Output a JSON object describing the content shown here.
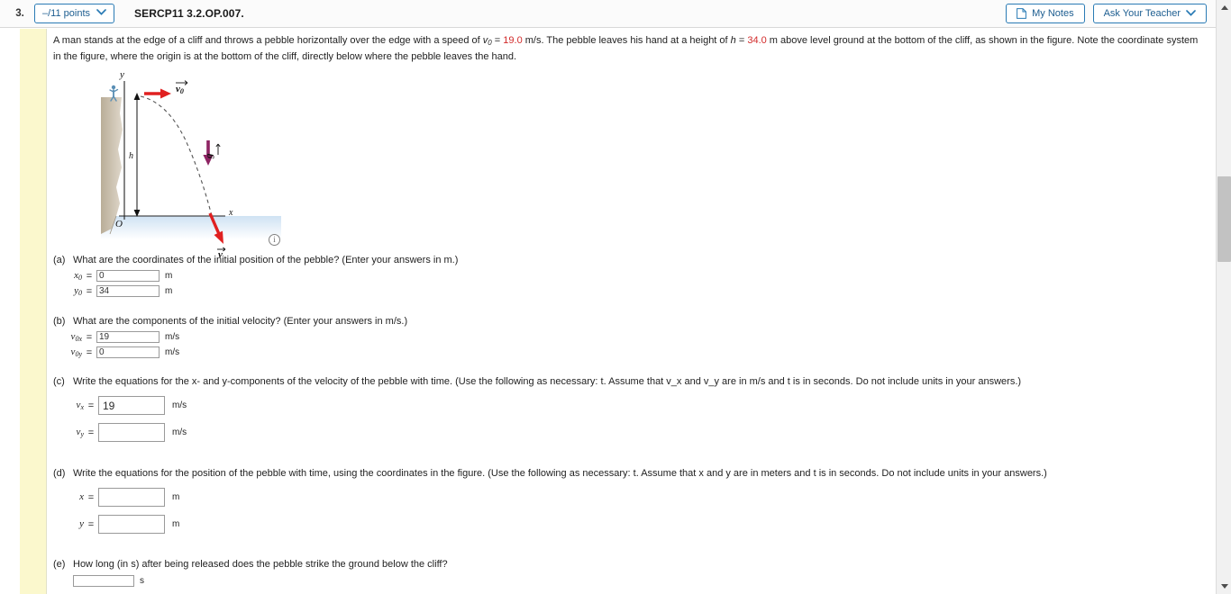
{
  "header": {
    "question_number": "3.",
    "points_label": "–/11 points",
    "points_chevron": "chevron-down-icon",
    "question_code": "SERCP11 3.2.OP.007.",
    "my_notes_label": "My Notes",
    "ask_teacher_label": "Ask Your Teacher",
    "ask_teacher_chevron": "chevron-down-icon"
  },
  "prompt": {
    "seg1": "A man stands at the edge of a cliff and throws a pebble horizontally over the edge with a speed of ",
    "v0_sym": "v",
    "v0_sub": "0",
    "eq1": " = ",
    "v0_value": "19.0",
    "seg2": " m/s. The pebble leaves his hand at a height of ",
    "h_sym": "h",
    "eq2": " = ",
    "h_value": "34.0",
    "seg3": " m above level ground at the bottom of the cliff, as shown in the figure. Note the coordinate system in the figure, where the origin is at the bottom of the cliff, directly below where the pebble leaves the hand."
  },
  "figure": {
    "axis_y_label": "y",
    "axis_x_label": "x",
    "origin_label": "O",
    "height_label": "h",
    "v0_label": "v",
    "v0_sub": "0",
    "g_label": "g",
    "v_label": "v",
    "info_icon": "info-icon",
    "info_glyph": "i",
    "arrow_color_velocity": "#e02020",
    "arrow_color_gravity": "#8e2463",
    "cliff_color": "#cfc5b4",
    "ground_color": "#dbe9f5"
  },
  "parts": [
    {
      "letter": "(a)",
      "question": "What are the coordinates of the initial position of the pebble? (Enter your answers in m.)",
      "fields": [
        {
          "label": "x",
          "sub": "0",
          "value": "0",
          "placeholder": "",
          "unit": "m"
        },
        {
          "label": "y",
          "sub": "0",
          "value": "34",
          "placeholder": "",
          "unit": "m"
        }
      ]
    },
    {
      "letter": "(b)",
      "question": "What are the components of the initial velocity? (Enter your answers in m/s.)",
      "fields": [
        {
          "label": "v",
          "sub": "0x",
          "value": "19",
          "placeholder": "",
          "unit": "m/s"
        },
        {
          "label": "v",
          "sub": "0y",
          "value": "0",
          "placeholder": "",
          "unit": "m/s"
        }
      ]
    },
    {
      "letter": "(c)",
      "question_pre": "Write the equations for the ",
      "question": "Write the equations for the x- and y-components of the velocity of the pebble with time. (Use the following as necessary: t. Assume that v_x and v_y are in m/s and t is in seconds. Do not include units in your answers.)",
      "fields": [
        {
          "label": "v",
          "sub": "x",
          "value": "19",
          "placeholder": "",
          "unit": "m/s"
        },
        {
          "label": "v",
          "sub": "y",
          "value": "",
          "placeholder": "",
          "unit": "m/s"
        }
      ]
    },
    {
      "letter": "(d)",
      "question": "Write the equations for the position of the pebble with time, using the coordinates in the figure. (Use the following as necessary: t. Assume that x and y are in meters and t is in seconds. Do not include units in your answers.)",
      "fields": [
        {
          "label": "x",
          "sub": "",
          "value": "",
          "placeholder": "",
          "unit": "m"
        },
        {
          "label": "y",
          "sub": "",
          "value": "",
          "placeholder": "",
          "unit": "m"
        }
      ]
    },
    {
      "letter": "(e)",
      "question": "How long (in s) after being released does the pebble strike the ground below the cliff?",
      "fields": [
        {
          "label": "",
          "sub": "",
          "value": "",
          "placeholder": "",
          "unit": "s"
        }
      ]
    }
  ],
  "scrollbar": {
    "up_arrow": "triangle-up-icon",
    "down_arrow": "triangle-down-icon"
  }
}
